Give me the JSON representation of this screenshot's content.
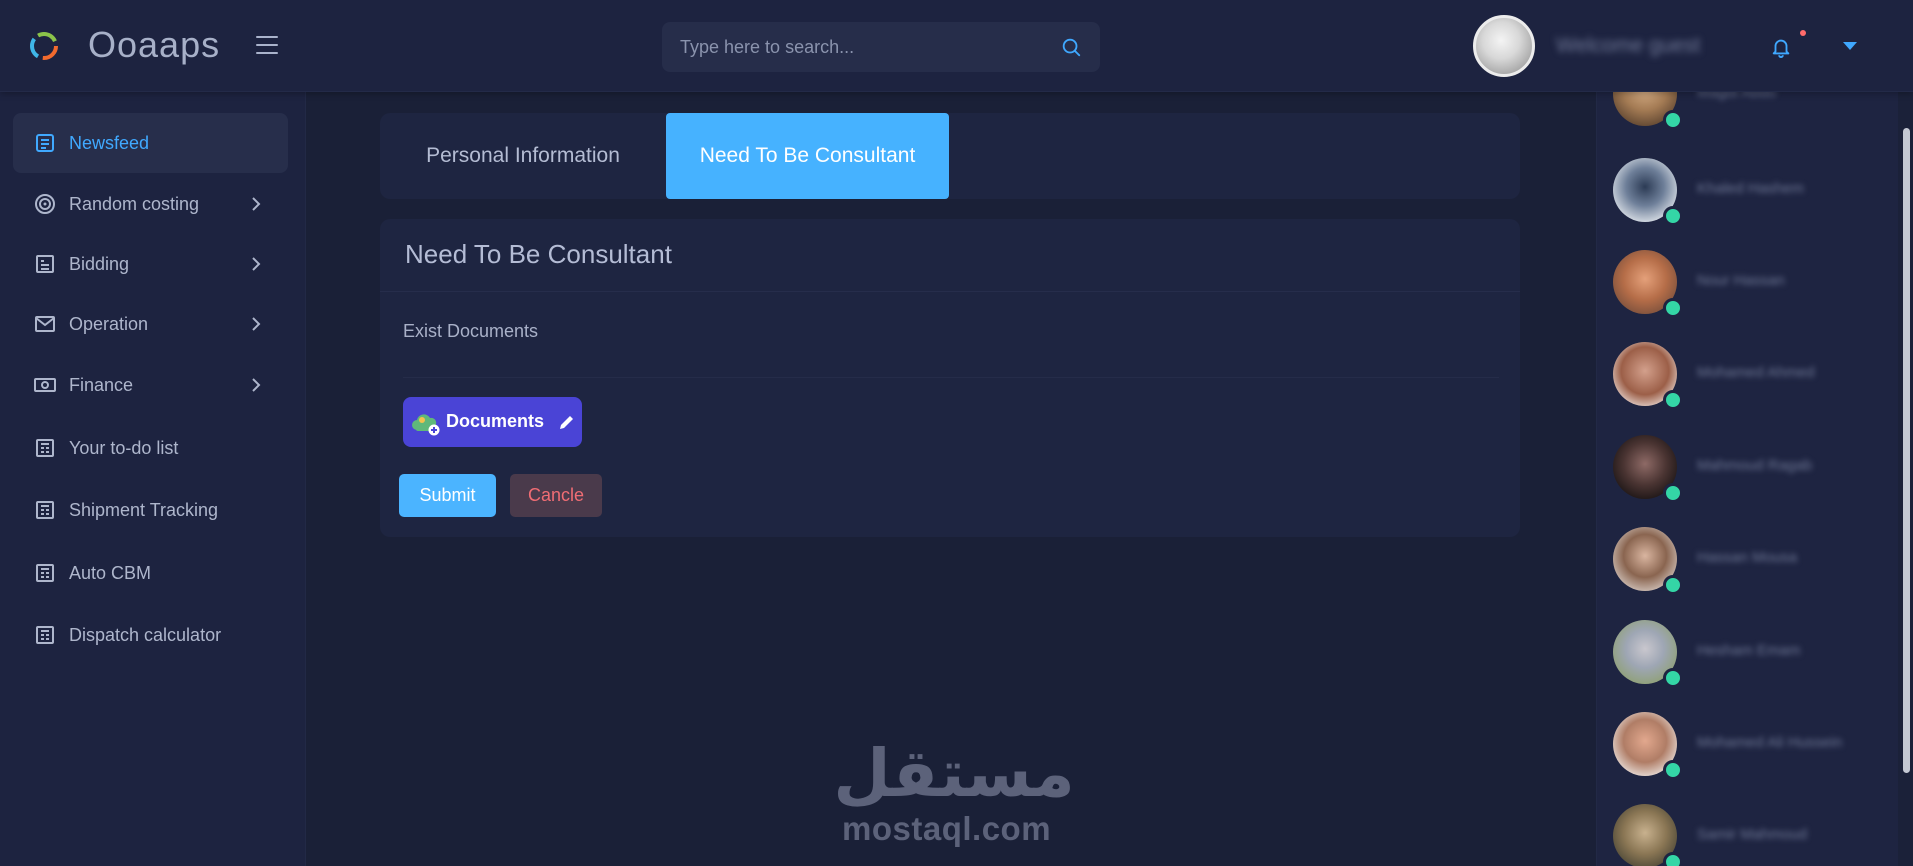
{
  "app": {
    "brand": "Ooaaps"
  },
  "header": {
    "search_placeholder": "Type here to search...",
    "welcome_text": "Welcome guest"
  },
  "sidebar": {
    "items": [
      {
        "label": "Newsfeed",
        "icon": "newspaper-icon",
        "active": true,
        "has_submenu": false
      },
      {
        "label": "Random costing",
        "icon": "target-icon",
        "active": false,
        "has_submenu": true
      },
      {
        "label": "Bidding",
        "icon": "list-icon",
        "active": false,
        "has_submenu": true
      },
      {
        "label": "Operation",
        "icon": "mail-icon",
        "active": false,
        "has_submenu": true
      },
      {
        "label": "Finance",
        "icon": "money-icon",
        "active": false,
        "has_submenu": true
      },
      {
        "label": "Your to-do list",
        "icon": "newspaper-icon",
        "active": false,
        "has_submenu": false
      },
      {
        "label": "Shipment Tracking",
        "icon": "newspaper-icon",
        "active": false,
        "has_submenu": false
      },
      {
        "label": "Auto CBM",
        "icon": "newspaper-icon",
        "active": false,
        "has_submenu": false
      },
      {
        "label": "Dispatch calculator",
        "icon": "newspaper-icon",
        "active": false,
        "has_submenu": false
      }
    ]
  },
  "tabs": [
    {
      "label": "Personal Information",
      "active": false
    },
    {
      "label": "Need To Be Consultant",
      "active": true
    }
  ],
  "form": {
    "title": "Need To Be Consultant",
    "exist_label": "Exist Documents",
    "documents_button": "Documents",
    "submit_label": "Submit",
    "cancel_label": "Cancle"
  },
  "watermark": {
    "arabic": "مستقل",
    "latin": "mostaql.com"
  },
  "contacts": [
    {
      "name": "Magdi Abdo",
      "online": true
    },
    {
      "name": "Khaled Hashem",
      "online": true
    },
    {
      "name": "Nour Hassan",
      "online": true
    },
    {
      "name": "Mohamed Ahmed",
      "online": true
    },
    {
      "name": "Mahmoud Ragab",
      "online": true
    },
    {
      "name": "Hassan Mousa",
      "online": true
    },
    {
      "name": "Hesham Emam",
      "online": true
    },
    {
      "name": "Mohamed Ali Hussein",
      "online": true
    },
    {
      "name": "Samir Mahmoud",
      "online": true
    }
  ],
  "colors": {
    "accent": "#46b2ff",
    "online": "#34d6a6",
    "documents_button": "#4a44d6",
    "cancel_text": "#f06d74"
  }
}
